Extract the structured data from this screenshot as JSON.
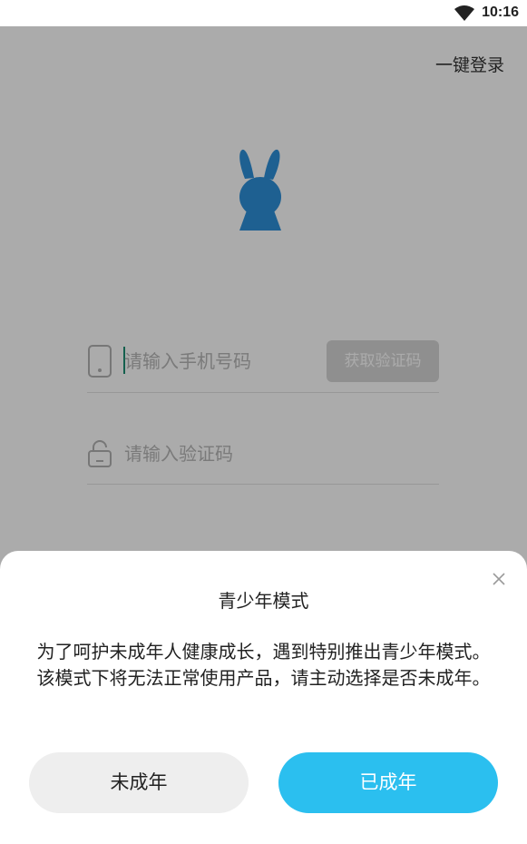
{
  "status_bar": {
    "time": "10:16",
    "wifi_icon": "wifi-icon"
  },
  "login": {
    "one_key_login": "一键登录",
    "logo_icon": "bunny-logo-icon",
    "phone": {
      "placeholder": "请输入手机号码",
      "value": "",
      "icon": "phone-icon"
    },
    "get_code_label": "获取验证码",
    "code": {
      "placeholder": "请输入验证码",
      "value": "",
      "icon": "lock-icon"
    }
  },
  "dialog": {
    "title": "青少年模式",
    "message": "为了呵护未成年人健康成长，遇到特别推出青少年模式。该模式下将无法正常使用产品，请主动选择是否未成年。",
    "close_icon": "close-icon",
    "minor_button": "未成年",
    "adult_button": "已成年"
  },
  "colors": {
    "accent": "#2bbfef",
    "logo": "#2d8fd9",
    "disabled_button": "#d5d5d5",
    "caret": "#1d8f73"
  }
}
